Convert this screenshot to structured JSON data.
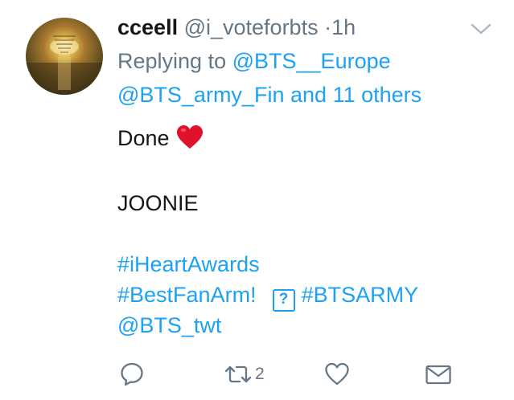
{
  "tweet": {
    "display_name": "cceell",
    "handle": "@i_voteforbts",
    "separator": "·",
    "time": "1h",
    "replying_to_label": "Replying to",
    "reply_to_user": "@BTS__Europe",
    "reply_to_second": "@BTS_army_Fin",
    "reply_and": "and",
    "reply_others": "11 others",
    "body": {
      "line1_text": "Done",
      "line1_emoji": "red-heart-emoji",
      "line2": "JOONIE",
      "hashtag1": "#iHeartAwards",
      "hashtag2": "#BestFanArm!",
      "unknown_glyph": "?",
      "hashtag3": "#BTSARMY",
      "mention": "@BTS_twt"
    }
  },
  "actions": {
    "reply_icon": "reply-bubble-icon",
    "retweet_icon": "retweet-icon",
    "retweet_count": "2",
    "like_icon": "heart-outline-icon",
    "dm_icon": "envelope-icon"
  },
  "colors": {
    "link": "#1da1f2",
    "muted": "#657786",
    "text": "#14171a",
    "heart": "#e0112b"
  }
}
